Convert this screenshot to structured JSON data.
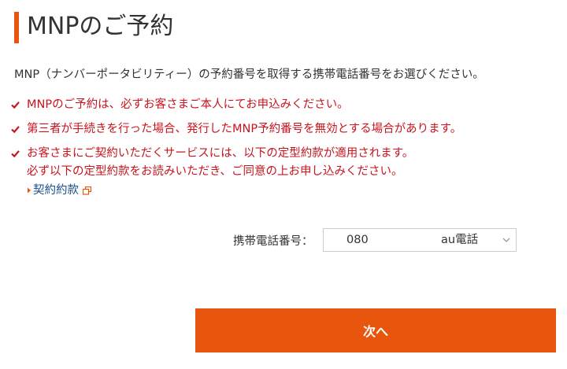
{
  "page": {
    "title": "MNPのご予約",
    "accent_color": "#e8560d"
  },
  "intro": "MNP（ナンバーポータビリティー）の予約番号を取得する携帯電話番号をお選びください。",
  "notes": [
    {
      "icon": "check-icon",
      "lines": [
        "MNPのご予約は、必ずお客さまご本人にてお申込みください。"
      ]
    },
    {
      "icon": "check-icon",
      "lines": [
        "第三者が手続きを行った場合、発行したMNP予約番号を無効とする場合があります。"
      ]
    },
    {
      "icon": "check-icon",
      "lines": [
        "お客さまにご契約いただくサービスには、以下の定型約款が適用されます。",
        "必ず以下の定型約款をお読みいただき、ご同意の上お申し込みください。"
      ]
    }
  ],
  "notes_color": "#c8141e",
  "contract_link": {
    "label": "契約約款",
    "icon": "external-link-icon"
  },
  "form": {
    "phone_label": "携帯電話番号：",
    "phone_number": "080",
    "carrier": "au電話",
    "select_icon": "chevron-down-icon"
  },
  "next_button": {
    "label": "次へ"
  }
}
